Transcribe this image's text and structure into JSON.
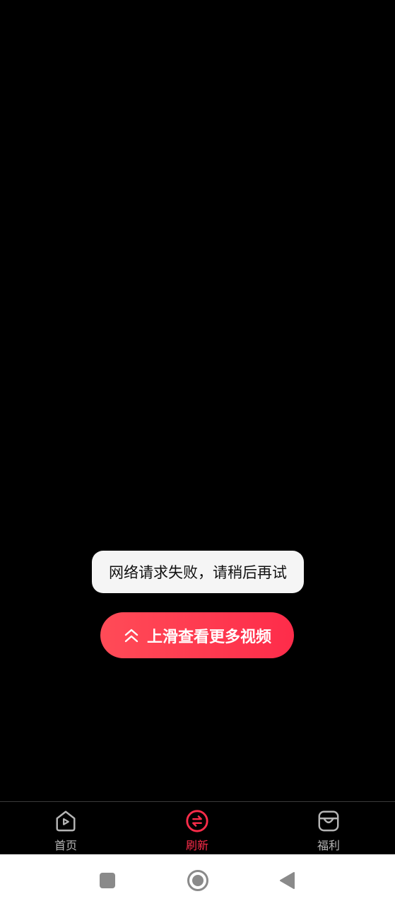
{
  "toast": {
    "message": "网络请求失败，请稍后再试"
  },
  "swipe_button": {
    "label": "上滑查看更多视频",
    "icon": "double-chevron-up-icon"
  },
  "tabs": [
    {
      "label": "首页",
      "icon": "home-play-icon",
      "active": false
    },
    {
      "label": "刷新",
      "icon": "refresh-swap-icon",
      "active": true
    },
    {
      "label": "福利",
      "icon": "welfare-bag-icon",
      "active": false
    }
  ],
  "colors": {
    "accent": "#fe2c4a",
    "inactive_tab": "#b5b5b5",
    "background": "#000000",
    "toast_bg": "#f5f5f5"
  },
  "system_nav": {
    "recent_icon": "square-recent-icon",
    "home_icon": "circle-home-icon",
    "back_icon": "triangle-back-icon"
  }
}
